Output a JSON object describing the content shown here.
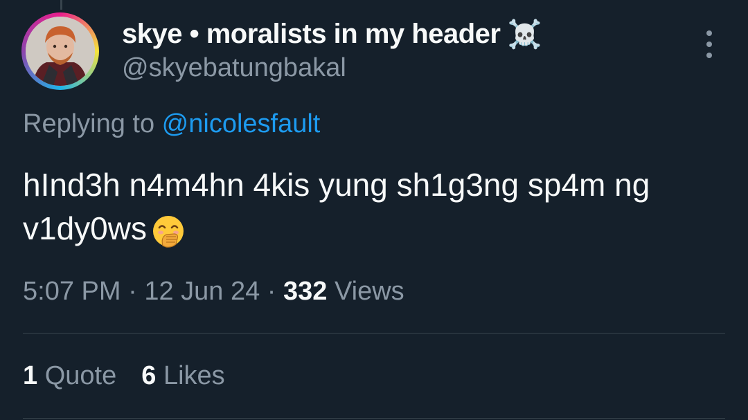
{
  "tweet": {
    "author_name": "skye • moralists in my header",
    "author_emoji": "☠️",
    "handle": "@skyebatungbakal",
    "replying_prefix": "Replying to ",
    "replying_to": "@nicolesfault",
    "text": "hInd3h n4m4hn 4kis yung sh1g3ng sp4m ng v1dy0ws",
    "text_emoji": "face-with-hand-over-mouth",
    "time": "5:07 PM",
    "date": "12 Jun 24",
    "views_count": "332",
    "views_label": "Views",
    "separator": " · "
  },
  "stats": {
    "quotes_count": "1",
    "quotes_label": "Quote",
    "likes_count": "6",
    "likes_label": "Likes"
  },
  "colors": {
    "background": "#15202b",
    "primary_text": "#f7f9f9",
    "secondary_text": "#8b98a5",
    "link": "#1d9bf0",
    "divider": "#38444d"
  }
}
